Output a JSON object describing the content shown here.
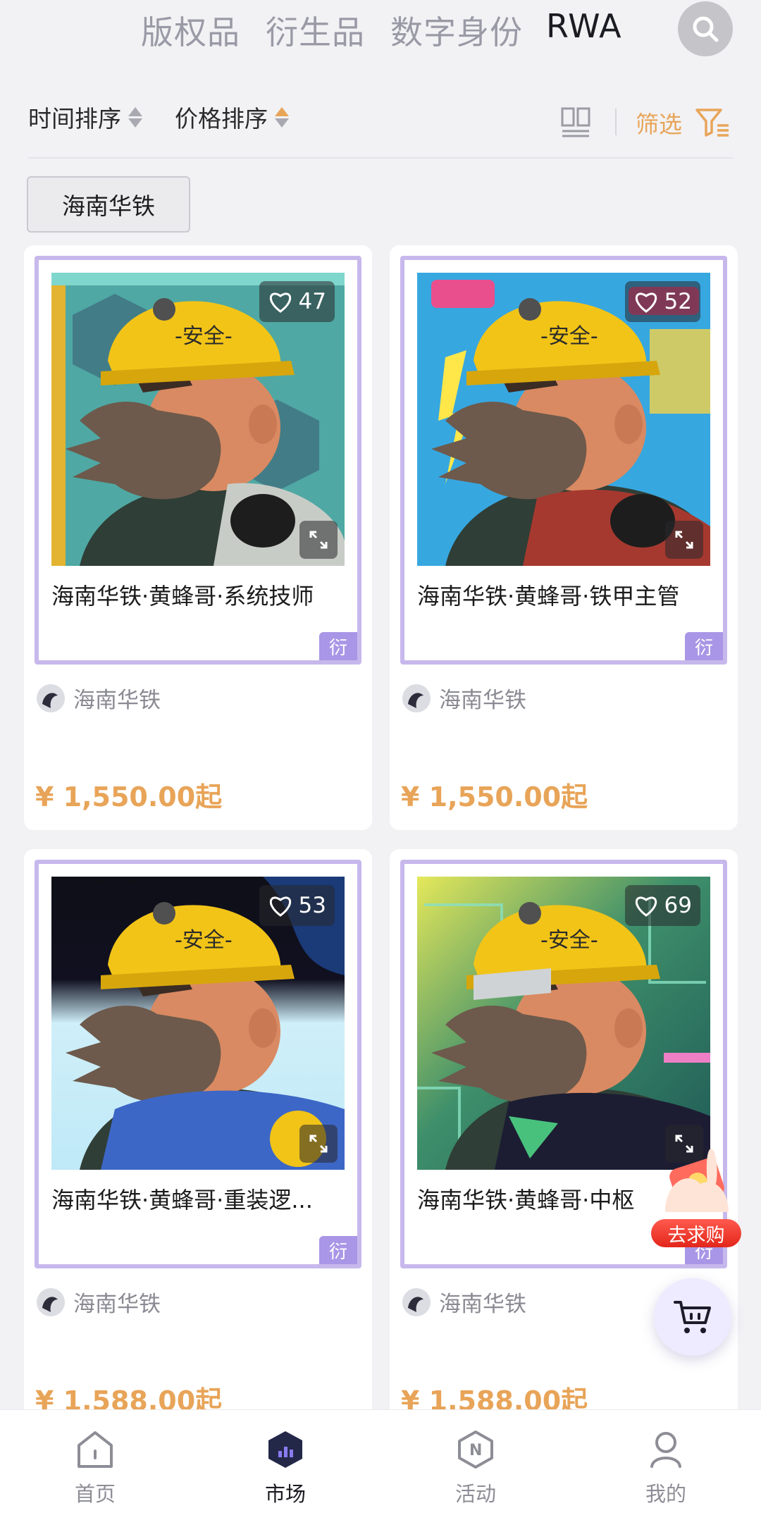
{
  "top_tabs": [
    {
      "label": "版权品",
      "active": false
    },
    {
      "label": "衍生品",
      "active": false
    },
    {
      "label": "数字身份",
      "active": false
    },
    {
      "label": "RWA",
      "active": true
    }
  ],
  "search": {
    "icon": "search-icon"
  },
  "sort": {
    "time_label": "时间排序",
    "price_label": "价格排序",
    "filter_label": "筛选",
    "accent_color": "#e8a55a"
  },
  "brand_chip": "海南华铁",
  "products": [
    {
      "title": "海南华铁·黄蜂哥·系统技师",
      "likes": "47",
      "tag": "衍",
      "creator": "海南华铁",
      "price": "¥ 1,550.00起"
    },
    {
      "title": "海南华铁·黄蜂哥·铁甲主管",
      "likes": "52",
      "tag": "衍",
      "creator": "海南华铁",
      "price": "¥ 1,550.00起"
    },
    {
      "title": "海南华铁·黄蜂哥·重装逻...",
      "likes": "53",
      "tag": "衍",
      "creator": "海南华铁",
      "price": "¥ 1,588.00起"
    },
    {
      "title": "海南华铁·黄蜂哥·中枢",
      "likes": "69",
      "tag": "衍",
      "creator": "海南华铁",
      "price": "¥ 1,588.00起"
    }
  ],
  "floating": {
    "want_buy_label": "去求购",
    "cart_icon": "cart-icon"
  },
  "bottom_nav": [
    {
      "label": "首页",
      "icon": "home-icon",
      "active": false
    },
    {
      "label": "市场",
      "icon": "market-icon",
      "active": true
    },
    {
      "label": "活动",
      "icon": "activity-icon",
      "active": false
    },
    {
      "label": "我的",
      "icon": "profile-icon",
      "active": false
    }
  ],
  "colors": {
    "frame": "#c7b8ec",
    "tag": "#a996e6",
    "price": "#e8a458",
    "want_buy": "#e3261b"
  }
}
